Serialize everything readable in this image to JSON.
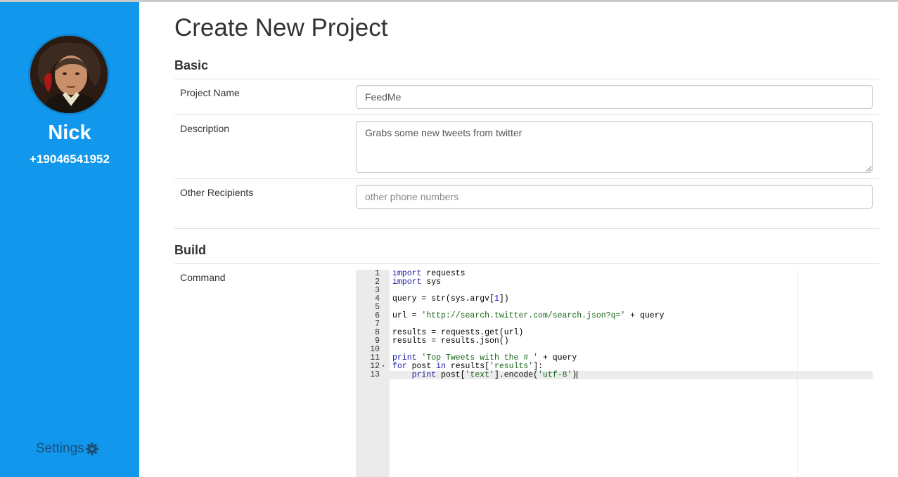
{
  "sidebar": {
    "user_name": "Nick",
    "phone": "+19046541952",
    "settings_label": "Settings",
    "settings_icon": "gear-icon",
    "avatar_icon": "user-portrait"
  },
  "page": {
    "title": "Create New Project"
  },
  "basic": {
    "title": "Basic",
    "project_name_label": "Project Name",
    "project_name_value": "FeedMe",
    "description_label": "Description",
    "description_value": "Grabs some new tweets from twitter",
    "recipients_label": "Other Recipients",
    "recipients_placeholder": "other phone numbers"
  },
  "build": {
    "title": "Build",
    "command_label": "Command",
    "code_lines": [
      {
        "n": "1",
        "t": [
          [
            "kw",
            "import"
          ],
          [
            "",
            " requests"
          ]
        ]
      },
      {
        "n": "2",
        "t": [
          [
            "kw",
            "import"
          ],
          [
            "",
            " sys"
          ]
        ]
      },
      {
        "n": "3",
        "t": []
      },
      {
        "n": "4",
        "t": [
          [
            "",
            "query = str(sys.argv["
          ],
          [
            "num",
            "1"
          ],
          [
            "",
            "])"
          ]
        ]
      },
      {
        "n": "5",
        "t": []
      },
      {
        "n": "6",
        "t": [
          [
            "",
            "url = "
          ],
          [
            "str",
            "'http://search.twitter.com/search.json?q='"
          ],
          [
            "",
            " + query"
          ]
        ]
      },
      {
        "n": "7",
        "t": []
      },
      {
        "n": "8",
        "t": [
          [
            "",
            "results = requests.get(url)"
          ]
        ]
      },
      {
        "n": "9",
        "t": [
          [
            "",
            "results = results.json()"
          ]
        ]
      },
      {
        "n": "10",
        "t": []
      },
      {
        "n": "11",
        "t": [
          [
            "kw",
            "print"
          ],
          [
            "",
            " "
          ],
          [
            "str",
            "'Top Tweets with the # '"
          ],
          [
            "",
            " + query"
          ]
        ]
      },
      {
        "n": "12",
        "fold": true,
        "t": [
          [
            "kw",
            "for"
          ],
          [
            "",
            " post "
          ],
          [
            "kw",
            "in"
          ],
          [
            "",
            " results["
          ],
          [
            "str",
            "'results'"
          ],
          [
            "",
            "]:"
          ]
        ]
      },
      {
        "n": "13",
        "active": true,
        "t": [
          [
            "",
            "    "
          ],
          [
            "kw",
            "print"
          ],
          [
            "",
            " post["
          ],
          [
            "str",
            "'text'"
          ],
          [
            "",
            "].encode("
          ],
          [
            "str",
            "'utf-8'"
          ],
          [
            "",
            ")"
          ]
        ]
      }
    ]
  },
  "colors": {
    "sidebar_bg": "#1197ec",
    "settings_text": "#1d4f78",
    "keyword": "#1a1aa6",
    "string": "#1a661a"
  }
}
